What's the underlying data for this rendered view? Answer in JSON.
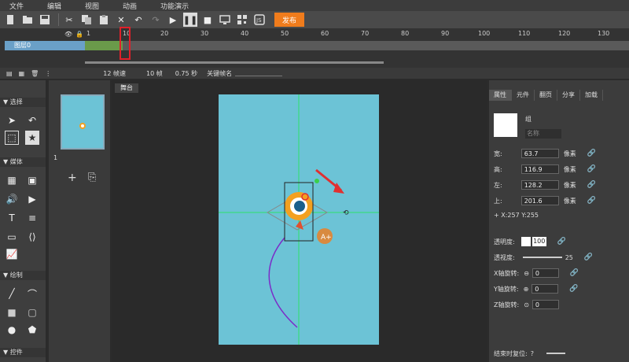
{
  "menu": [
    "文件",
    "编辑",
    "视图",
    "动画",
    "功能演示"
  ],
  "toolbar": {
    "publish_label": "发布"
  },
  "timeline": {
    "ruler_ticks": [
      "1",
      "10",
      "20",
      "30",
      "40",
      "50",
      "60",
      "70",
      "80",
      "90",
      "100",
      "110",
      "120",
      "130"
    ],
    "layer_name": "图层0"
  },
  "status": {
    "fps": "12 帧速",
    "frames": "10 帧",
    "time": "0.75 秒",
    "keyframe_label": "关键帧名"
  },
  "tools": {
    "section_select": "选择",
    "section_media": "媒体",
    "section_draw": "绘制",
    "section_control": "控件"
  },
  "thumbs": {
    "index": "1"
  },
  "stage": {
    "tab_label": "舞台"
  },
  "props": {
    "tabs": [
      "属性",
      "元件",
      "翻页",
      "分享",
      "加载"
    ],
    "group_label": "组",
    "name_placeholder": "名称",
    "width_label": "宽:",
    "width_value": "63.7",
    "height_label": "高:",
    "height_value": "116.9",
    "left_label": "左:",
    "left_value": "128.2",
    "top_label": "上:",
    "top_value": "201.6",
    "unit": "像素",
    "coords": "+ X:257   Y:255",
    "opacity_label": "透明度:",
    "opacity_value": "100",
    "perspective_label": "透视度:",
    "perspective_value": "25",
    "xrot_label": "X轴旋转:",
    "xrot_value": "0",
    "yrot_label": "Y轴旋转:",
    "yrot_value": "0",
    "zrot_label": "Z轴旋转:",
    "zrot_value": "0",
    "reset_label": "结束时复位:"
  }
}
